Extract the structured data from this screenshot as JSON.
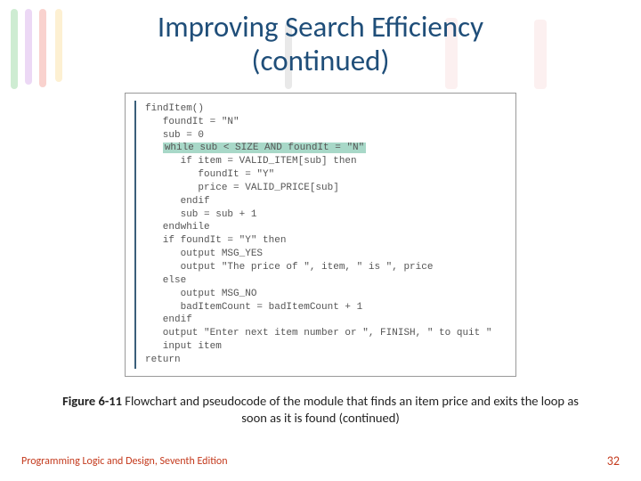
{
  "title_line1": "Improving Search Efficiency",
  "title_line2": "(continued)",
  "code": {
    "l01": "findItem()",
    "l02": "   foundIt = \"N\"",
    "l03": "   sub = 0",
    "l04": "   while sub < SIZE AND foundIt = \"N\"",
    "l05": "      if item = VALID_ITEM[sub] then",
    "l06": "         foundIt = \"Y\"",
    "l07": "         price = VALID_PRICE[sub]",
    "l08": "      endif",
    "l09": "      sub = sub + 1",
    "l10": "   endwhile",
    "l11": "   if foundIt = \"Y\" then",
    "l12": "      output MSG_YES",
    "l13": "      output \"The price of \", item, \" is \", price",
    "l14": "   else",
    "l15": "      output MSG_NO",
    "l16": "      badItemCount = badItemCount + 1",
    "l17": "   endif",
    "l18": "   output \"Enter next item number or \", FINISH, \" to quit \"",
    "l19": "   input item",
    "l20": "return"
  },
  "caption": {
    "fig": "Figure 6-11",
    "text": " Flowchart and pseudocode of the module that finds an item price and exits the loop as soon as it is found (continued)"
  },
  "footer": {
    "left": "Programming Logic and Design, Seventh Edition",
    "right": "32"
  },
  "decoration_colors": [
    "#3bb44a",
    "#8e44ad",
    "#e74c3c",
    "#f39c12",
    "#2c3e50",
    "#e74c3c",
    "#e74c3c"
  ]
}
